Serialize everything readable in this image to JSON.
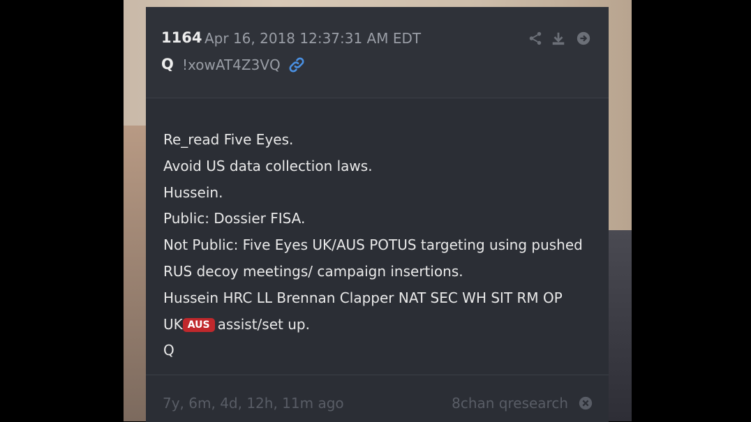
{
  "post": {
    "number": "1164",
    "date": "Apr 16, 2018 12:37:31 AM EDT",
    "author": "Q",
    "tripcode": "!xowAT4Z3VQ",
    "lines": [
      "Re_read Five Eyes.",
      "Avoid US data collection laws.",
      "Hussein.",
      "Public: Dossier FISA.",
      "Not Public: Five Eyes UK/AUS POTUS targeting using pushed",
      "RUS decoy meetings/ campaign insertions.",
      "Hussein HRC LL Brennan Clapper NAT SEC WH SIT RM OP"
    ],
    "line_uk_prefix": "UK",
    "tag_aus": "AUS",
    "line_uk_suffix": "assist/set up.",
    "signature": "Q"
  },
  "footer": {
    "age": "7y, 6m, 4d, 12h, 11m ago",
    "board": "8chan qresearch"
  },
  "icons": {
    "header": [
      "share-icon",
      "download-icon",
      "arrow-right-circle-icon"
    ],
    "author": "link-icon",
    "footer": "close-circle-icon"
  },
  "colors": {
    "card_background": "#2b2e35",
    "link_accent": "#4a90e2",
    "tag_red": "#c0282c"
  }
}
